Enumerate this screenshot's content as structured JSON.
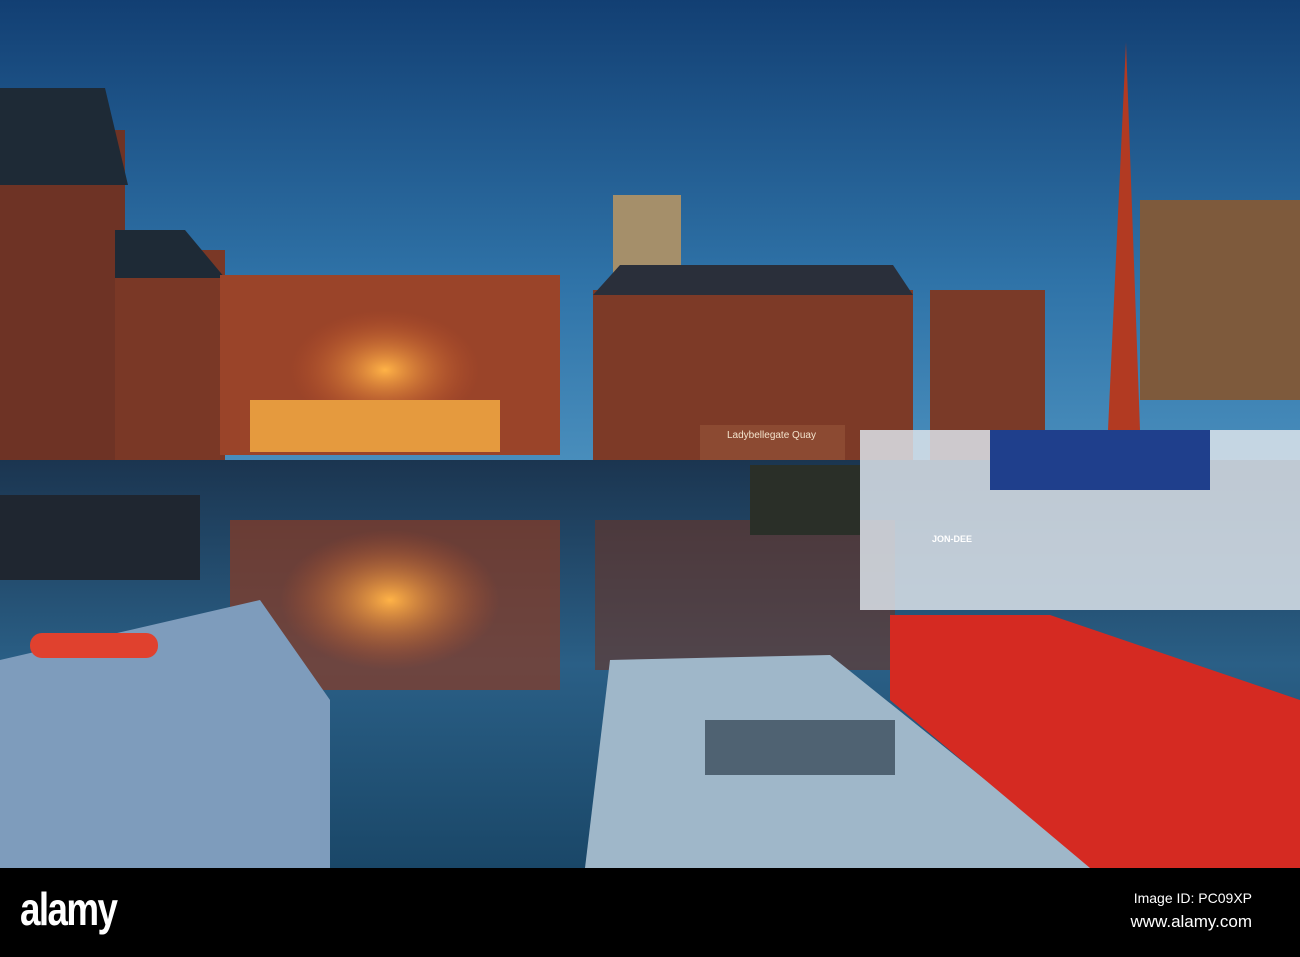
{
  "photo": {
    "sign_text": "Ladybellegate Quay",
    "boat_name": "JON-DEE",
    "colors": {
      "sky_top": "#1a4f86",
      "sky_low": "#3f86b8",
      "water": "#0d2a45",
      "brick": "#8a3f2c",
      "boat_red": "#d52a22",
      "boat_roof": "#9fb7c9"
    }
  },
  "footer": {
    "logo": "alamy",
    "image_id": "Image ID: PC09XP",
    "url": "www.alamy.com"
  }
}
